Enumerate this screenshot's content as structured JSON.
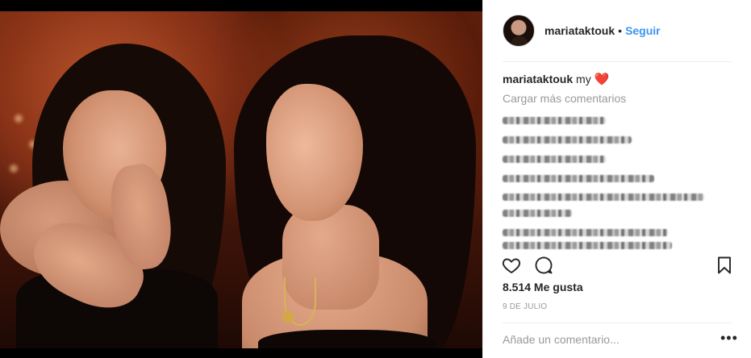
{
  "post": {
    "author": {
      "username": "mariataktouk",
      "separator": "•",
      "follow_label": "Seguir"
    },
    "caption": {
      "username": "mariataktouk",
      "text": "my",
      "emoji": "❤️"
    },
    "load_more_label": "Cargar más comentarios",
    "likes_text": "8.514 Me gusta",
    "date_text": "9 DE JULIO",
    "comment_placeholder": "Añade un comentario...",
    "more_options_label": "•••"
  },
  "icons": {
    "like": "heart-outline-icon",
    "comment": "speech-bubble-icon",
    "save": "bookmark-icon",
    "more": "ellipsis-icon"
  },
  "colors": {
    "accent": "#3897f0",
    "heart": "#e0245e",
    "muted": "#999999",
    "text": "#262626"
  }
}
